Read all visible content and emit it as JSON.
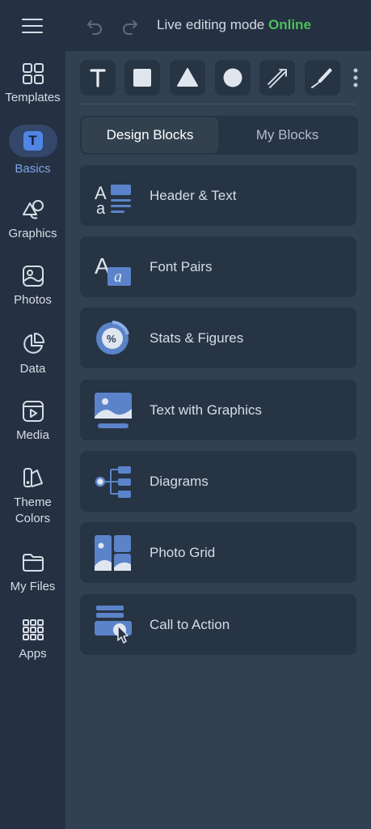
{
  "header": {
    "live_label": "Live editing mode",
    "status_label": "Online",
    "status_color": "#4cc05a"
  },
  "sidebar": {
    "items": [
      {
        "label": "Templates",
        "icon": "templates-icon"
      },
      {
        "label": "Basics",
        "icon": "basics-icon",
        "active": true
      },
      {
        "label": "Graphics",
        "icon": "graphics-icon"
      },
      {
        "label": "Photos",
        "icon": "photos-icon"
      },
      {
        "label": "Data",
        "icon": "data-icon"
      },
      {
        "label": "Media",
        "icon": "media-icon"
      },
      {
        "label": "Theme\nColors",
        "icon": "theme-colors-icon"
      },
      {
        "label": "My Files",
        "icon": "my-files-icon"
      },
      {
        "label": "Apps",
        "icon": "apps-icon"
      }
    ],
    "basics_glyph": "T"
  },
  "tools": [
    "text-tool",
    "rectangle-tool",
    "triangle-tool",
    "circle-tool",
    "line-tool",
    "pen-tool"
  ],
  "tabs": {
    "design_blocks": "Design Blocks",
    "my_blocks": "My Blocks"
  },
  "blocks": [
    {
      "label": "Header & Text",
      "icon": "header-text-icon"
    },
    {
      "label": "Font Pairs",
      "icon": "font-pairs-icon"
    },
    {
      "label": "Stats & Figures",
      "icon": "stats-figures-icon"
    },
    {
      "label": "Text with Graphics",
      "icon": "text-graphics-icon"
    },
    {
      "label": "Diagrams",
      "icon": "diagrams-icon"
    },
    {
      "label": "Photo Grid",
      "icon": "photo-grid-icon"
    },
    {
      "label": "Call to Action",
      "icon": "call-to-action-icon"
    }
  ],
  "colors": {
    "accent": "#4f86e3",
    "panel_bg": "#324152",
    "sidebar_bg": "#253142"
  }
}
